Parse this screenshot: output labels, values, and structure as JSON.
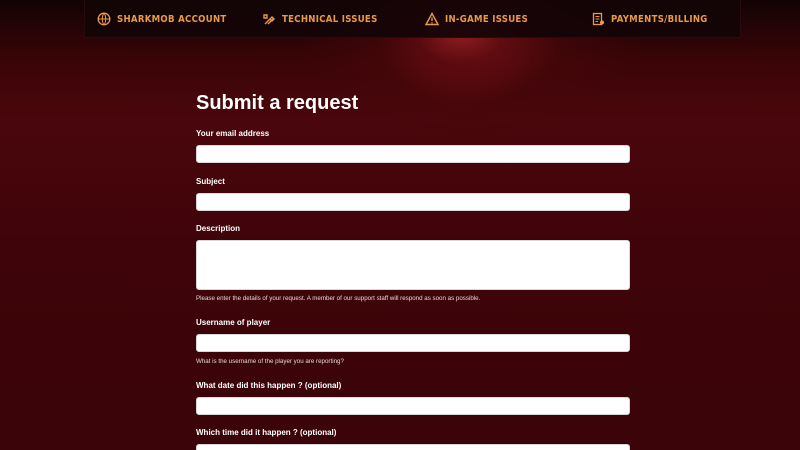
{
  "nav": {
    "items": [
      {
        "label": "SHARKMOB ACCOUNT",
        "icon": "globe-icon"
      },
      {
        "label": "TECHNICAL ISSUES",
        "icon": "tools-icon"
      },
      {
        "label": "IN-GAME ISSUES",
        "icon": "warning-icon"
      },
      {
        "label": "PAYMENTS/BILLING",
        "icon": "receipt-icon"
      }
    ],
    "accent_color": "#e89a4a"
  },
  "form": {
    "title": "Submit a request",
    "fields": [
      {
        "label": "Your email address",
        "value": "",
        "hint": ""
      },
      {
        "label": "Subject",
        "value": "",
        "hint": ""
      },
      {
        "label": "Description",
        "value": "",
        "hint": "Please enter the details of your request. A member of our support staff will respond as soon as possible."
      },
      {
        "label": "Username of player",
        "value": "",
        "hint": "What is the username of the player you are reporting?"
      },
      {
        "label": "What date did this happen ? (optional)",
        "value": "",
        "hint": ""
      },
      {
        "label": "Which time did it happen ? (optional)",
        "value": "",
        "hint": ""
      }
    ]
  }
}
